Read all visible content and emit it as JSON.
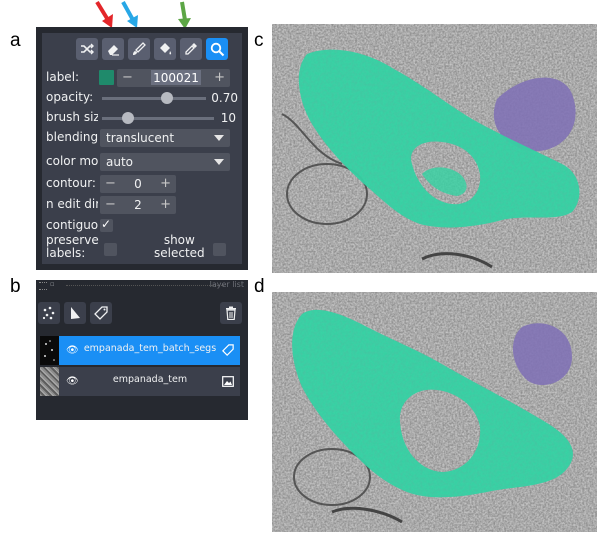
{
  "figure_labels": {
    "a": "a",
    "b": "b",
    "c": "c",
    "d": "d"
  },
  "arrow_colors": {
    "red": "#e3262a",
    "blue": "#27a7e6",
    "green": "#5ca645"
  },
  "colors": {
    "accent": "#1a8ff5",
    "panel_bg": "#262930",
    "widget_bg": "#3b3f4b",
    "segmentation": "#33d3a3",
    "label_swatch": "#1f8a6b",
    "other_segment": "#7f71b5"
  },
  "toolbar": {
    "icons": [
      "shuffle-icon",
      "eraser-icon",
      "brush-icon",
      "fill-bucket-icon",
      "eyedropper-icon",
      "magnifier-icon"
    ],
    "active": "magnifier-icon"
  },
  "controls": {
    "label": {
      "text": "label:",
      "value": "100021",
      "minus": "−",
      "plus": "+"
    },
    "opacity": {
      "text": "opacity:",
      "value": "0.70",
      "fraction": 0.7
    },
    "brush_size": {
      "text": "brush siz",
      "value": "10",
      "fraction": 0.08
    },
    "blending": {
      "text": "blending",
      "value": "translucent"
    },
    "color_mode": {
      "text": "color mo",
      "value": "auto"
    },
    "contour": {
      "text": "contour:",
      "value": "0",
      "minus": "−",
      "plus": "+"
    },
    "n_edit_dim": {
      "text": "n edit dir",
      "value": "2",
      "minus": "−",
      "plus": "+"
    },
    "contiguous": {
      "text": "contiguo",
      "checked": true,
      "check": "✓"
    },
    "preserve_labels": {
      "text": "preserve labels:",
      "line1": "preserve",
      "line2": "labels:",
      "checked": false
    },
    "show_selected": {
      "line1": "show",
      "line2": "selected",
      "checked": false
    }
  },
  "layer_list": {
    "title": "layer list",
    "buttons": [
      "points-icon",
      "shapes-icon",
      "labels-tag-icon",
      "trash-icon"
    ],
    "layers": [
      {
        "name": "empanada_tem_batch_segs",
        "type": "labels",
        "visible": true,
        "selected": true
      },
      {
        "name": "empanada_tem",
        "type": "image",
        "visible": true,
        "selected": false
      }
    ]
  }
}
